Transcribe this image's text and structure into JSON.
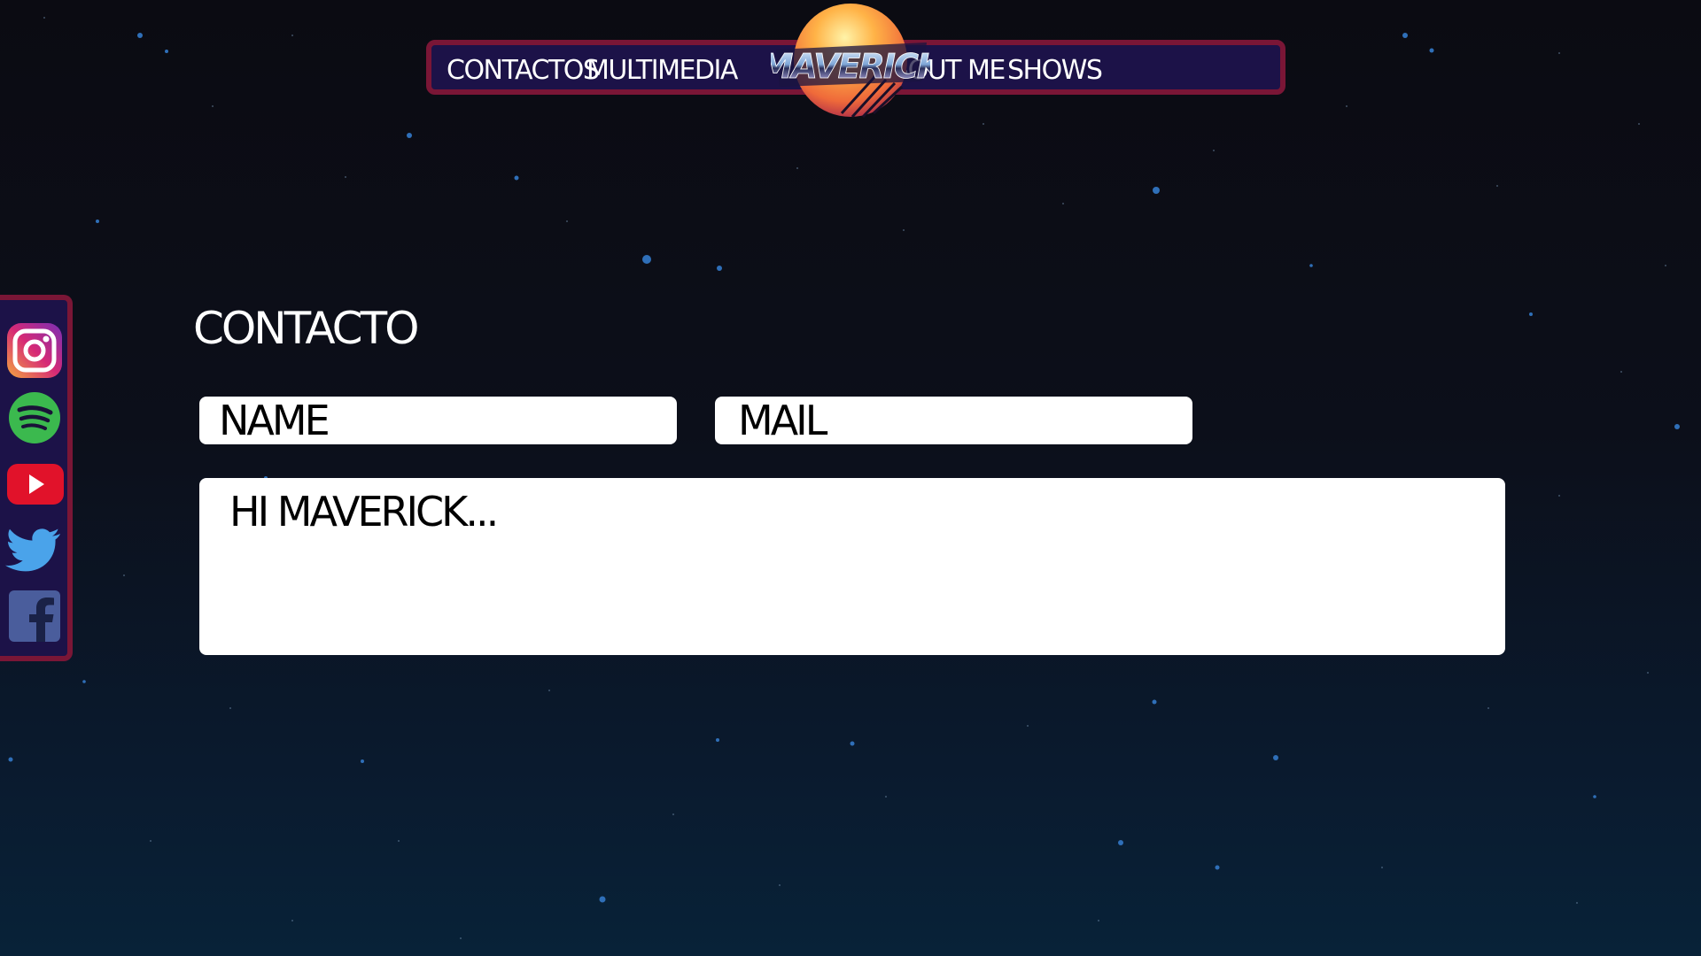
{
  "nav": {
    "links": [
      {
        "label": "CONTACTOS"
      },
      {
        "label": "MULTIMEDIA"
      },
      {
        "label": "ABOUT ME"
      },
      {
        "label": "SHOWS"
      }
    ],
    "logo_text": "MAVERICK"
  },
  "social": {
    "items": [
      {
        "name": "instagram",
        "icon": "instagram-icon"
      },
      {
        "name": "spotify",
        "icon": "spotify-icon"
      },
      {
        "name": "youtube",
        "icon": "youtube-icon"
      },
      {
        "name": "twitter",
        "icon": "twitter-icon"
      },
      {
        "name": "facebook",
        "icon": "facebook-icon"
      }
    ]
  },
  "contact": {
    "title": "CONTACTO",
    "name_placeholder": "NAME",
    "mail_placeholder": "MAIL",
    "message_placeholder": "HI MAVERICK..."
  },
  "colors": {
    "frame_border": "#7a1636",
    "frame_fill": "#1c1248",
    "background_top": "#0b0b12",
    "background_bottom": "#082238",
    "field_background": "#ffffff"
  }
}
